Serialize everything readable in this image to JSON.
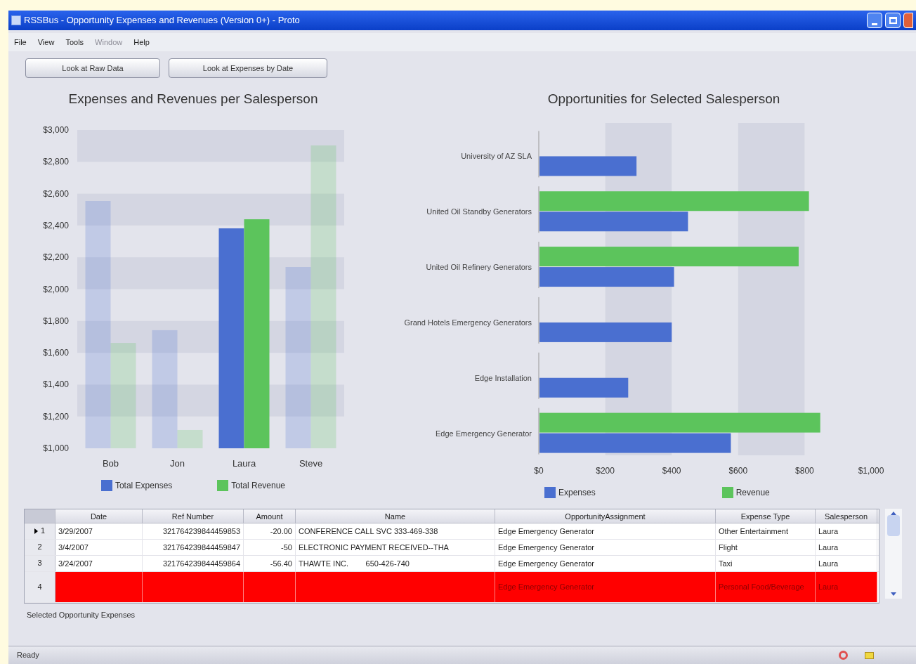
{
  "window": {
    "title": "RSSBus - Opportunity Expenses and Revenues (Version 0+) - Proto"
  },
  "menu": [
    {
      "label": "File",
      "disabled": false
    },
    {
      "label": "View",
      "disabled": false
    },
    {
      "label": "Tools",
      "disabled": false
    },
    {
      "label": "Window",
      "disabled": true
    },
    {
      "label": "Help",
      "disabled": false
    }
  ],
  "toolbar_buttons": [
    "Look at Raw Data",
    "Look at Expenses by Date"
  ],
  "left_chart": {
    "category_selected": [
      false,
      false,
      true,
      false
    ],
    "chart_data": {
      "type": "bar",
      "title": "Expenses and Revenues per Salesperson",
      "categories": [
        "Bob",
        "Jon",
        "Laura",
        "Steve"
      ],
      "series": [
        {
          "name": "Total Expenses",
          "color": "#4a6fd0",
          "values": [
            2554,
            1742,
            2382,
            2139
          ]
        },
        {
          "name": "Total Revenue",
          "color": "#5cc45c",
          "values": [
            1662,
            1115,
            2439,
            2903
          ]
        }
      ],
      "ylim": [
        1000,
        3000
      ],
      "yticks": [
        {
          "value": 1000,
          "label": "$1,000"
        },
        {
          "value": 1200,
          "label": "$1,200"
        },
        {
          "value": 1400,
          "label": "$1,400"
        },
        {
          "value": 1600,
          "label": "$1,600"
        },
        {
          "value": 1800,
          "label": "$1,800"
        },
        {
          "value": 2000,
          "label": "$2,000"
        },
        {
          "value": 2200,
          "label": "$2,200"
        },
        {
          "value": 2400,
          "label": "$2,400"
        },
        {
          "value": 2600,
          "label": "$2,600"
        },
        {
          "value": 2800,
          "label": "$2,800"
        },
        {
          "value": 3000,
          "label": "$3,000"
        }
      ]
    }
  },
  "right_chart": {
    "chart_data": {
      "type": "bar",
      "orientation": "horizontal",
      "title": "Opportunities for Selected Salesperson",
      "categories": [
        "University of AZ SLA",
        "United Oil Standby Generators",
        "United Oil Refinery Generators",
        "Grand Hotels Emergency Generators",
        "Edge Installation",
        "Edge Emergency Generator"
      ],
      "series": [
        {
          "name": "Expenses",
          "color": "#4a6fd0",
          "values": [
            292,
            447,
            405,
            398,
            267,
            576
          ]
        },
        {
          "name": "Revenue",
          "color": "#5cc45c",
          "values": [
            null,
            811,
            780,
            null,
            null,
            845
          ]
        }
      ],
      "xlim": [
        0,
        1000
      ],
      "xticks": [
        {
          "value": 0,
          "label": "$0"
        },
        {
          "value": 200,
          "label": "$200"
        },
        {
          "value": 400,
          "label": "$400"
        },
        {
          "value": 600,
          "label": "$600"
        },
        {
          "value": 800,
          "label": "$800"
        },
        {
          "value": 1000,
          "label": "$1,000"
        }
      ]
    }
  },
  "table": {
    "columns": [
      "Date",
      "Ref Number",
      "Amount",
      "Name",
      "OpportunityAssignment",
      "Expense Type",
      "Salesperson"
    ],
    "rows": [
      {
        "number": "1",
        "current": true,
        "flagged": false,
        "cells": [
          "3/29/2007",
          "321764239844459853",
          "-20.00",
          "CONFERENCE CALL SVC 333-469-338",
          "Edge Emergency Generator",
          "Other Entertainment",
          "Laura"
        ]
      },
      {
        "number": "2",
        "current": false,
        "flagged": false,
        "cells": [
          "3/4/2007",
          "321764239844459847",
          "-50",
          "ELECTRONIC PAYMENT RECEIVED--THA",
          "Edge Emergency Generator",
          "Flight",
          "Laura"
        ]
      },
      {
        "number": "3",
        "current": false,
        "flagged": false,
        "cells": [
          "3/24/2007",
          "321764239844459864",
          "-56.40",
          "THAWTE INC.        650-426-740",
          "Edge Emergency Generator",
          "Taxi",
          "Laura"
        ]
      },
      {
        "number": "4",
        "current": false,
        "flagged": true,
        "cells": [
          null,
          null,
          null,
          null,
          "Edge Emergency Generator",
          "Personal Food/Beverage",
          "Laura"
        ]
      }
    ]
  },
  "table_label": "Selected Opportunity Expenses",
  "status_bar": {
    "text": "Ready"
  }
}
